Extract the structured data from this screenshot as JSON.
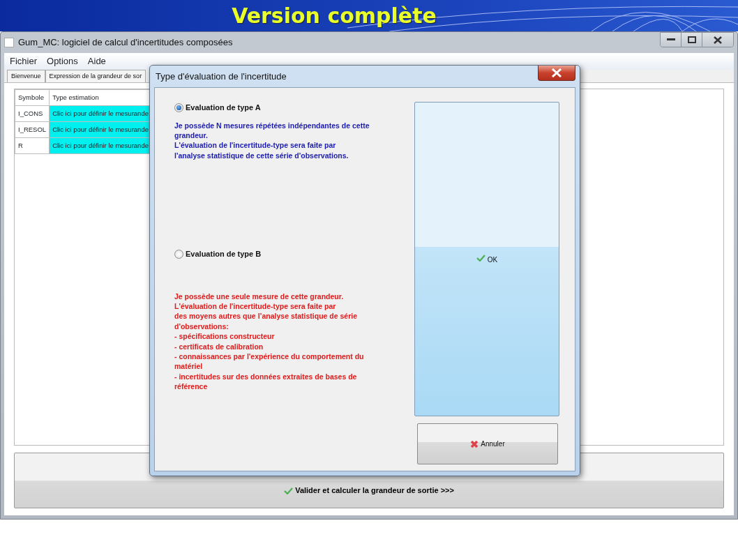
{
  "banner": {
    "title": "Version complète"
  },
  "window": {
    "title": "Gum_MC: logiciel de calcul d'incertitudes composées"
  },
  "menu": [
    "Fichier",
    "Options",
    "Aide"
  ],
  "tabs": [
    "Bienvenue",
    "Expression de la grandeur de sor"
  ],
  "table": {
    "columns": [
      "Symbole",
      "Type estimation"
    ],
    "rows": [
      {
        "symbol": "I_CONS",
        "type": "Clic ici pour définir le mesurande"
      },
      {
        "symbol": "I_RESOL",
        "type": "Clic ici pour définir le mesurande"
      },
      {
        "symbol": "R",
        "type": "Clic ici pour définir le mesurande"
      }
    ]
  },
  "validate_button": "Valider et calculer la grandeur de sortie >>>",
  "dialog": {
    "title": "Type d'évaluation de l'incertitude",
    "options": [
      {
        "label": "Evaluation de type A",
        "selected": true,
        "color": "#1c1cb0",
        "lines": [
          "Je possède N mesures répétées indépendantes de cette",
          "grandeur.",
          "L'évaluation de l'incertitude-type sera faite par",
          "l'analyse statistique de cette série d'observations."
        ]
      },
      {
        "label": "Evaluation de type B",
        "selected": false,
        "color": "#e01b1b",
        "lines": [
          "Je possède une seule mesure de cette grandeur.",
          "L'évaluation de l'incertitude-type sera faite par",
          "des moyens autres que l’analyse statistique de série",
          "d'observations:",
          "- spécifications constructeur",
          "- certificats de calibration",
          "- connaissances par l'expérience du comportement du",
          "matériel",
          "- incertitudes sur des données extraites de bases de",
          "référence"
        ]
      }
    ],
    "ok_button": "OK",
    "cancel_button": "Annuler"
  }
}
